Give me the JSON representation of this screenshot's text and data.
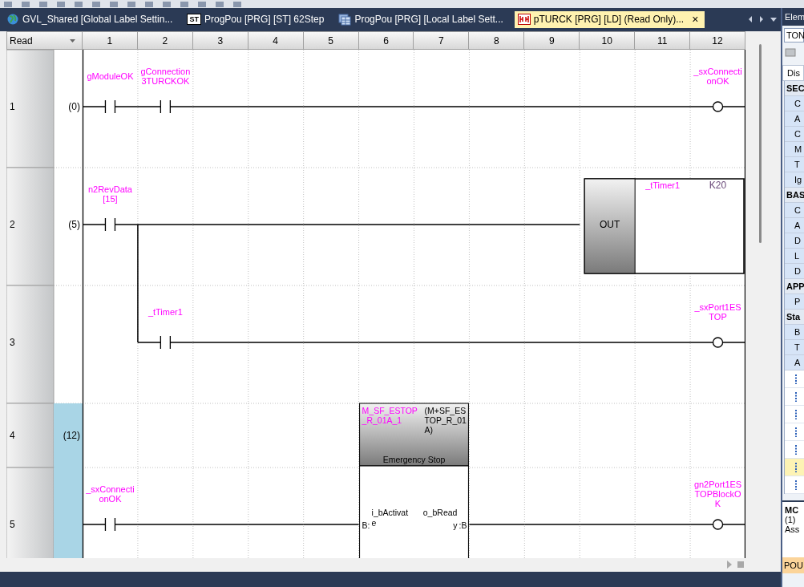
{
  "tabs": [
    {
      "label": "GVL_Shared [Global Label Settin...",
      "kind": "global",
      "selected": false
    },
    {
      "label": "ProgPou [PRG] [ST] 62Step",
      "kind": "structured",
      "icon_text": "ST",
      "selected": false
    },
    {
      "label": "ProgPou [PRG] [Local Label Sett...",
      "kind": "local",
      "selected": false
    },
    {
      "label": "pTURCK [PRG] [LD] (Read Only)...",
      "kind": "ladder",
      "selected": true,
      "close": "×"
    }
  ],
  "editor": {
    "mode": "Read",
    "columns": [
      "1",
      "2",
      "3",
      "4",
      "5",
      "6",
      "7",
      "8",
      "9",
      "10",
      "11",
      "12"
    ],
    "rungs": [
      {
        "row": "1",
        "step": "(0)",
        "highlighted": false,
        "cells": [
          {
            "kind": "contact",
            "label": [
              "gModuleOK"
            ]
          },
          {
            "kind": "contact",
            "label": [
              "gConnection",
              "3TURCKOK"
            ]
          },
          {
            "kind": "wire"
          },
          {
            "kind": "wire"
          },
          {
            "kind": "wire"
          },
          {
            "kind": "wire"
          },
          {
            "kind": "wire"
          },
          {
            "kind": "wire"
          },
          {
            "kind": "wire"
          },
          {
            "kind": "wire"
          },
          {
            "kind": "wire"
          },
          {
            "kind": "coil",
            "label": [
              "_sxConnecti",
              "onOK"
            ]
          }
        ]
      },
      {
        "row": "2",
        "step": "(5)",
        "highlighted": false,
        "cells": [
          {
            "kind": "contact",
            "label": [
              "n2RevData",
              "[15]"
            ]
          },
          {
            "kind": "wire"
          },
          {
            "kind": "wire"
          },
          {
            "kind": "wire"
          },
          {
            "kind": "wire"
          },
          {
            "kind": "wire"
          },
          {
            "kind": "wire"
          },
          {
            "kind": "wire"
          },
          {
            "kind": "wire"
          },
          {
            "kind": "out_box",
            "text": "OUT"
          },
          {
            "kind": "out_operand",
            "text": "_tTimer1"
          },
          {
            "kind": "out_value",
            "text": "K20"
          }
        ]
      },
      {
        "row": "3",
        "highlighted": false,
        "cells": [
          {
            "kind": "empty"
          },
          {
            "kind": "contact",
            "branch_in": true,
            "label": [
              "_tTimer1"
            ]
          },
          {
            "kind": "wire"
          },
          {
            "kind": "wire"
          },
          {
            "kind": "wire"
          },
          {
            "kind": "wire"
          },
          {
            "kind": "wire"
          },
          {
            "kind": "wire"
          },
          {
            "kind": "wire"
          },
          {
            "kind": "wire"
          },
          {
            "kind": "wire"
          },
          {
            "kind": "coil",
            "label": [
              "_sxPort1ES",
              "TOP"
            ]
          }
        ]
      },
      {
        "row": "4",
        "step": "(12)",
        "highlighted": true,
        "cells": [
          {
            "kind": "empty"
          },
          {
            "kind": "empty"
          },
          {
            "kind": "empty"
          },
          {
            "kind": "empty"
          },
          {
            "kind": "empty"
          },
          {
            "kind": "fb_header",
            "instance": [
              "M_SF_ESTOP",
              "_R_01A_1"
            ],
            "type": [
              "(M+SF_ES",
              "TOP_R_01",
              "A)"
            ],
            "comment": "Emergency Stop"
          },
          {
            "kind": "covered"
          },
          {
            "kind": "empty"
          },
          {
            "kind": "empty"
          },
          {
            "kind": "empty"
          },
          {
            "kind": "empty"
          },
          {
            "kind": "empty"
          }
        ]
      },
      {
        "row": "5",
        "highlighted": true,
        "cells": [
          {
            "kind": "contact",
            "label": [
              "_sxConnecti",
              "onOK"
            ]
          },
          {
            "kind": "wire"
          },
          {
            "kind": "wire"
          },
          {
            "kind": "wire"
          },
          {
            "kind": "wire"
          },
          {
            "kind": "fb_body",
            "input_type": "B:",
            "input": [
              "i_bActivat",
              "e"
            ],
            "output": [
              "o_bRead",
              "y"
            ],
            "output_type": ":B"
          },
          {
            "kind": "covered"
          },
          {
            "kind": "wire"
          },
          {
            "kind": "wire"
          },
          {
            "kind": "wire"
          },
          {
            "kind": "wire"
          },
          {
            "kind": "coil",
            "label": [
              "gn2Port1ES",
              "TOPBlockO",
              "K"
            ]
          }
        ]
      }
    ]
  },
  "element_panel": {
    "title": "Elem",
    "search": {
      "value": "TON"
    },
    "tab": "Dis",
    "items": [
      {
        "kind": "group",
        "text": "SEC"
      },
      {
        "kind": "item",
        "text": "C"
      },
      {
        "kind": "item",
        "text": "A"
      },
      {
        "kind": "item",
        "text": "C"
      },
      {
        "kind": "item",
        "text": "M"
      },
      {
        "kind": "item",
        "text": "T"
      },
      {
        "kind": "item",
        "text": "Ig"
      },
      {
        "kind": "group",
        "text": "BAS"
      },
      {
        "kind": "item",
        "text": "C"
      },
      {
        "kind": "item",
        "text": "A"
      },
      {
        "kind": "item",
        "text": "D"
      },
      {
        "kind": "item",
        "text": "L"
      },
      {
        "kind": "item",
        "text": "D"
      },
      {
        "kind": "group",
        "text": "APP"
      },
      {
        "kind": "item",
        "text": "P"
      },
      {
        "kind": "group",
        "text": "Sta"
      },
      {
        "kind": "item",
        "text": "B"
      },
      {
        "kind": "item",
        "text": "T"
      },
      {
        "kind": "item",
        "text": "A"
      },
      {
        "kind": "icon",
        "selected": false
      },
      {
        "kind": "icon",
        "selected": false
      },
      {
        "kind": "icon",
        "selected": false
      },
      {
        "kind": "icon",
        "selected": false
      },
      {
        "kind": "icon",
        "selected": false
      },
      {
        "kind": "icon",
        "selected": true
      },
      {
        "kind": "icon",
        "selected": false
      }
    ],
    "detail": {
      "title": "MC",
      "lines": [
        "(1)",
        "Ass"
      ]
    },
    "bottom_tab": "POU"
  }
}
